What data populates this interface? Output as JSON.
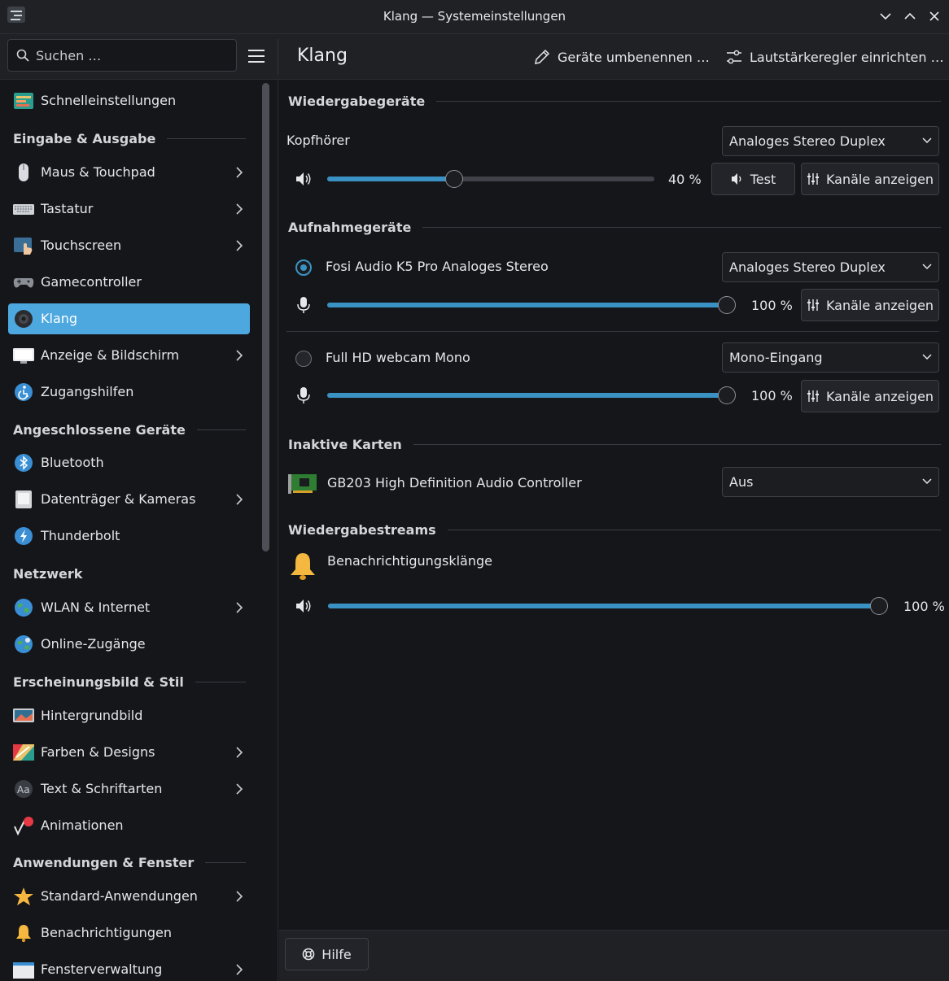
{
  "window": {
    "title": "Klang — Systemeinstellungen"
  },
  "toolbar": {
    "search_placeholder": "Suchen …",
    "page_title": "Klang",
    "rename_devices": "Geräte umbenennen …",
    "volume_controls": "Lautstärkeregler einrichten …"
  },
  "sidebar": {
    "quick_settings": "Schnelleinstellungen",
    "sections": {
      "io": "Eingabe & Ausgabe",
      "devices": "Angeschlossene Geräte",
      "network": "Netzwerk",
      "appearance": "Erscheinungsbild & Stil",
      "apps": "Anwendungen & Fenster"
    },
    "items": {
      "mouse": "Maus & Touchpad",
      "keyboard": "Tastatur",
      "touchscreen": "Touchscreen",
      "gamecontroller": "Gamecontroller",
      "sound": "Klang",
      "display": "Anzeige & Bildschirm",
      "accessibility": "Zugangshilfen",
      "bluetooth": "Bluetooth",
      "storage": "Datenträger & Kameras",
      "thunderbolt": "Thunderbolt",
      "wifi": "WLAN & Internet",
      "online_accounts": "Online-Zugänge",
      "wallpaper": "Hintergrundbild",
      "colors": "Farben & Designs",
      "fonts": "Text & Schriftarten",
      "animations": "Animationen",
      "default_apps": "Standard-Anwendungen",
      "notifications": "Benachrichtigungen",
      "window_management": "Fensterverwaltung"
    }
  },
  "main": {
    "playback": {
      "header": "Wiedergabegeräte",
      "device_name": "Kopfhörer",
      "profile": "Analoges Stereo Duplex",
      "volume": 40,
      "volume_label": "40 %",
      "test_label": "Test",
      "channels_label": "Kanäle anzeigen"
    },
    "recording": {
      "header": "Aufnahmegeräte",
      "devices": [
        {
          "name": "Fosi Audio K5 Pro Analoges Stereo",
          "profile": "Analoges Stereo Duplex",
          "volume": 100,
          "volume_label": "100 %",
          "default": true,
          "channels_label": "Kanäle anzeigen"
        },
        {
          "name": "Full HD webcam Mono",
          "profile": "Mono-Eingang",
          "volume": 100,
          "volume_label": "100 %",
          "default": false,
          "channels_label": "Kanäle anzeigen"
        }
      ]
    },
    "inactive": {
      "header": "Inaktive Karten",
      "card_name": "GB203 High Definition Audio Controller",
      "profile": "Aus"
    },
    "streams": {
      "header": "Wiedergabestreams",
      "stream_name": "Benachrichtigungsklänge",
      "volume": 100,
      "volume_label": "100 %"
    }
  },
  "footer": {
    "help_label": "Hilfe"
  },
  "colors": {
    "accent": "#3a92c4",
    "selection": "#4da8e0",
    "background": "#15161a",
    "chrome": "#1f2125"
  }
}
